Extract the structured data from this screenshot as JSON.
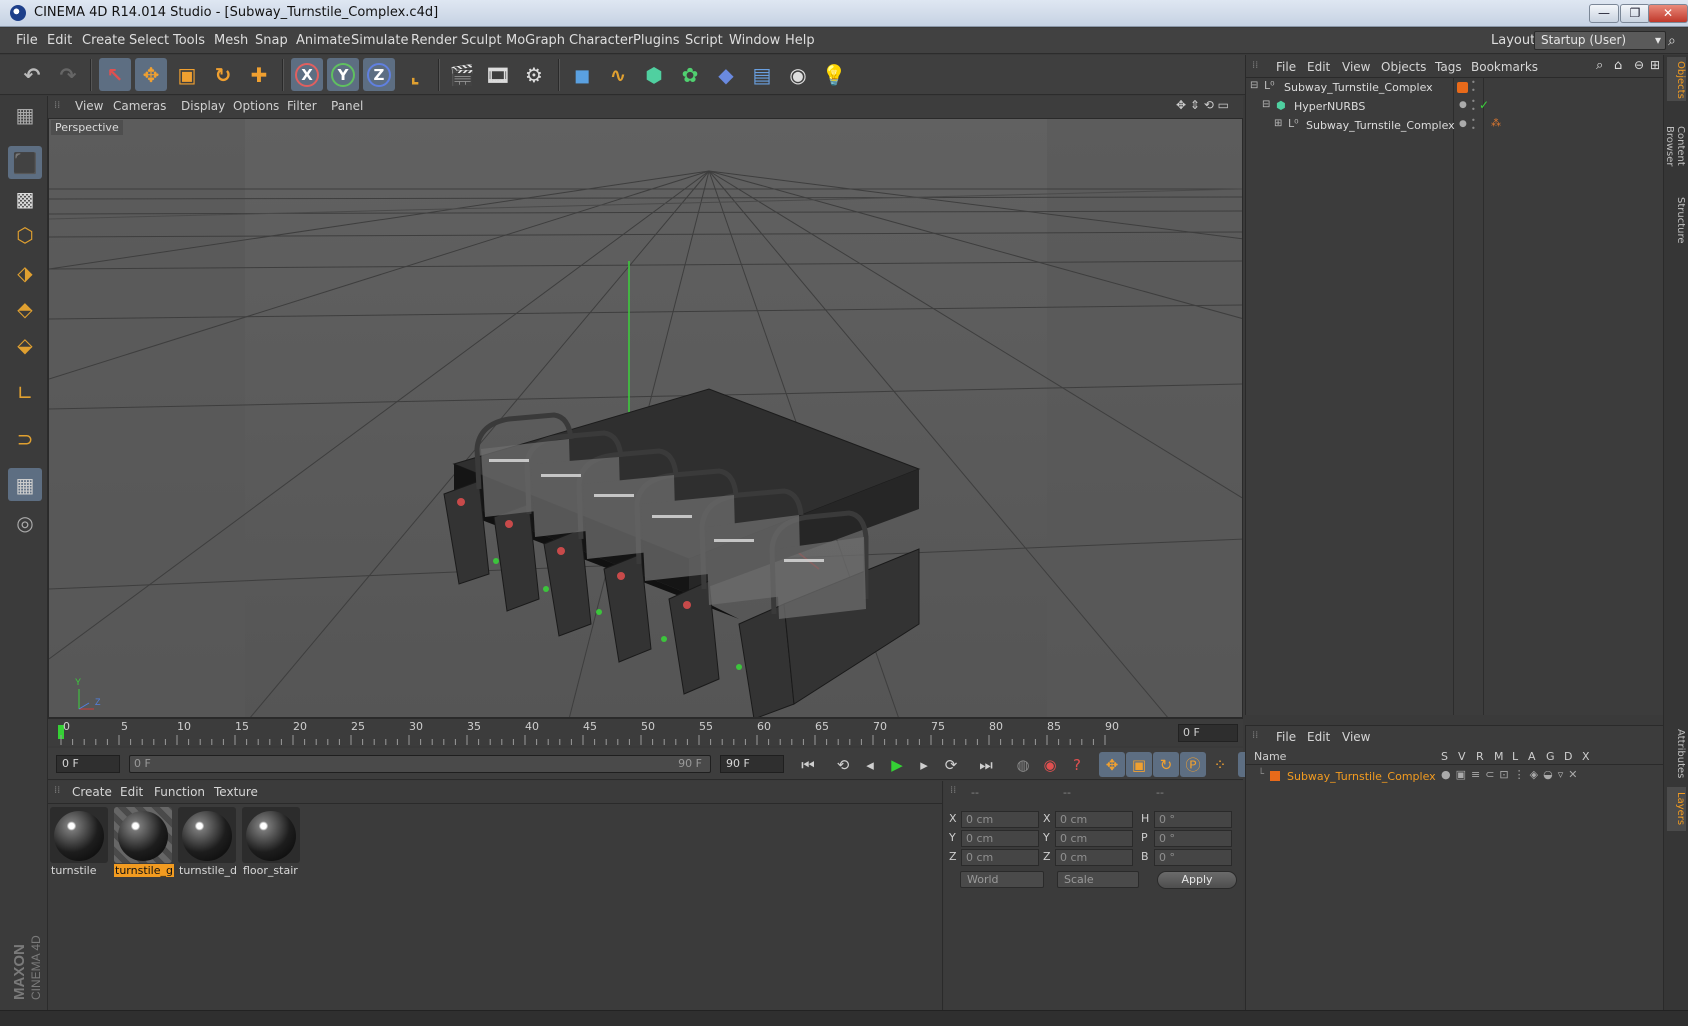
{
  "window": {
    "title": "CINEMA 4D R14.014 Studio - [Subway_Turnstile_Complex.c4d]",
    "controls": [
      "—",
      "❐",
      "✕"
    ]
  },
  "menubar": {
    "items": [
      "File",
      "Edit",
      "Create",
      "Select",
      "Tools",
      "Mesh",
      "Snap",
      "Animate",
      "Simulate",
      "Render",
      "Sculpt",
      "MoGraph",
      "Character",
      "Plugins",
      "Script",
      "Window",
      "Help"
    ],
    "layout_label": "Layout:",
    "layout_value": "Startup (User)"
  },
  "toolbar": {
    "axis_x": "X",
    "axis_y": "Y",
    "axis_z": "Z"
  },
  "viewport": {
    "menu": [
      "View",
      "Cameras",
      "Display",
      "Options",
      "Filter",
      "Panel"
    ],
    "label": "Perspective",
    "axis_y": "Y",
    "axis_z": "Z"
  },
  "timeline": {
    "ticks": [
      "0",
      "5",
      "10",
      "15",
      "20",
      "25",
      "30",
      "35",
      "40",
      "45",
      "50",
      "55",
      "60",
      "65",
      "70",
      "75",
      "80",
      "85",
      "90"
    ],
    "current_frame": "0 F"
  },
  "playbar": {
    "start_field": "0 F",
    "range_start": "0 F",
    "range_end": "90 F",
    "end_field": "90 F"
  },
  "material_manager": {
    "menu": [
      "Create",
      "Edit",
      "Function",
      "Texture"
    ],
    "materials": [
      "turnstile",
      "turnstile_g",
      "turnstile_d",
      "floor_stair"
    ],
    "selected_index": 1
  },
  "coordinates": {
    "headers": [
      "--",
      "--",
      "--"
    ],
    "pos_axes": [
      "X",
      "Y",
      "Z"
    ],
    "pos_values": [
      "0 cm",
      "0 cm",
      "0 cm"
    ],
    "size_axes": [
      "X",
      "Y",
      "Z"
    ],
    "size_values": [
      "0 cm",
      "0 cm",
      "0 cm"
    ],
    "rot_axes": [
      "H",
      "P",
      "B"
    ],
    "rot_values": [
      "0 °",
      "0 °",
      "0 °"
    ],
    "world_dropdown": "World",
    "scale_dropdown": "Scale",
    "apply_label": "Apply"
  },
  "object_manager": {
    "menu": [
      "File",
      "Edit",
      "View",
      "Objects",
      "Tags",
      "Bookmarks"
    ],
    "rows": [
      {
        "name": "Subway_Turnstile_Complex"
      },
      {
        "name": "HyperNURBS"
      },
      {
        "name": "Subway_Turnstile_Complex"
      }
    ]
  },
  "layer_manager": {
    "menu": [
      "File",
      "Edit",
      "View"
    ],
    "columns": [
      "Name",
      "S",
      "V",
      "R",
      "M",
      "L",
      "A",
      "G",
      "D",
      "X"
    ],
    "layer_name": "Subway_Turnstile_Complex"
  },
  "side_tabs": [
    "Objects",
    "Content Browser",
    "Structure",
    "Attributes",
    "Layers"
  ],
  "logo": {
    "brand": "MAXON",
    "product": "CINEMA 4D"
  },
  "colors": {
    "accent": "#f29b20",
    "selection": "#5d6e82",
    "viewport_bg": "#5c5c5c"
  }
}
